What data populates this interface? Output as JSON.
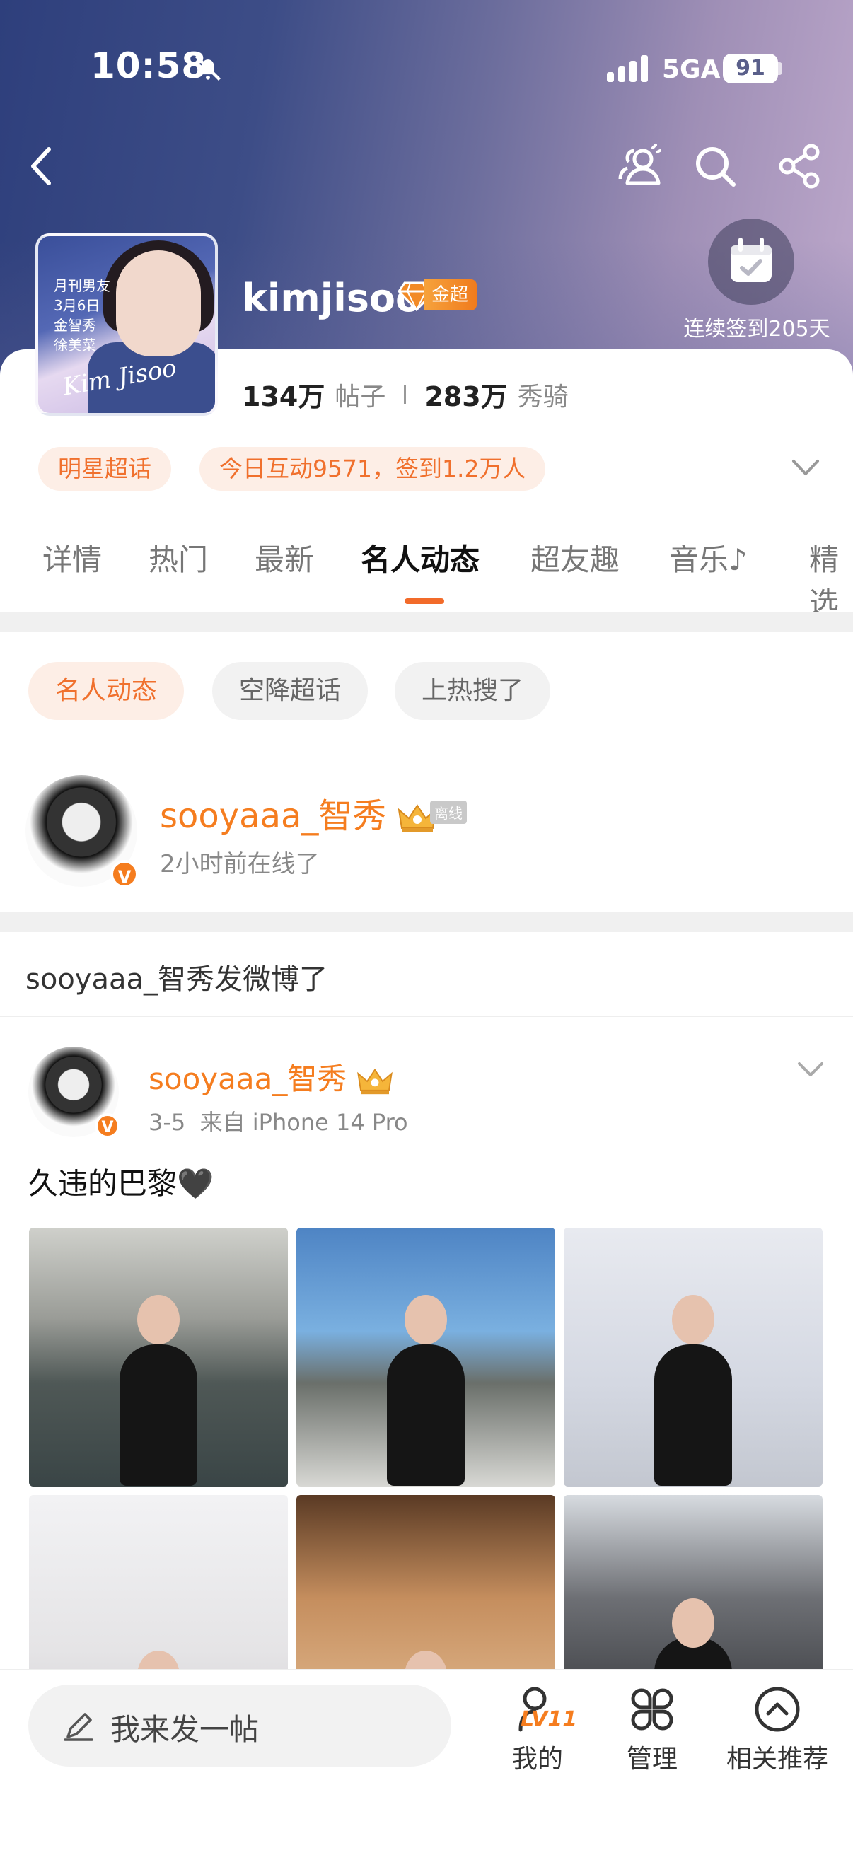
{
  "status_bar": {
    "time": "10:58",
    "network": "5GA",
    "battery": "91"
  },
  "header": {
    "title": "kimjisoo",
    "badge": "金超",
    "checkin_text": "连续签到205天",
    "cover_text": "月刊男友\n3月6日\n金智秀\n徐美菜",
    "cover_script": "Kim Jisoo"
  },
  "stats": {
    "posts_value": "134万",
    "posts_label": "帖子",
    "fans_value": "283万",
    "fans_label": "秀骑"
  },
  "tags": {
    "category": "明星超话",
    "activity": "今日互动9571，签到1.2万人"
  },
  "tabs": [
    "详情",
    "热门",
    "最新",
    "名人动态",
    "超友趣",
    "音乐♪",
    "精选"
  ],
  "active_tab": "名人动态",
  "filters": [
    "名人动态",
    "空降超话",
    "上热搜了"
  ],
  "celebrity": {
    "name": "sooyaaa_智秀",
    "status_badge": "离线",
    "online_text": "2小时前在线了"
  },
  "feed_notice": "sooyaaa_智秀发微博了",
  "post": {
    "author": "sooyaaa_智秀",
    "date": "3-5",
    "source": "来自 iPhone 14 Pro",
    "text": "久违的巴黎🖤",
    "photo_count": 6
  },
  "bottom_bar": {
    "compose_placeholder": "我来发一帖",
    "level": "LV11",
    "mine": "我的",
    "manage": "管理",
    "recommend": "相关推荐"
  },
  "colors": {
    "accent": "#f57d1f",
    "tag_bg": "#fdeee6",
    "header_start": "#2e3f7c",
    "header_end": "#bda8cb"
  }
}
